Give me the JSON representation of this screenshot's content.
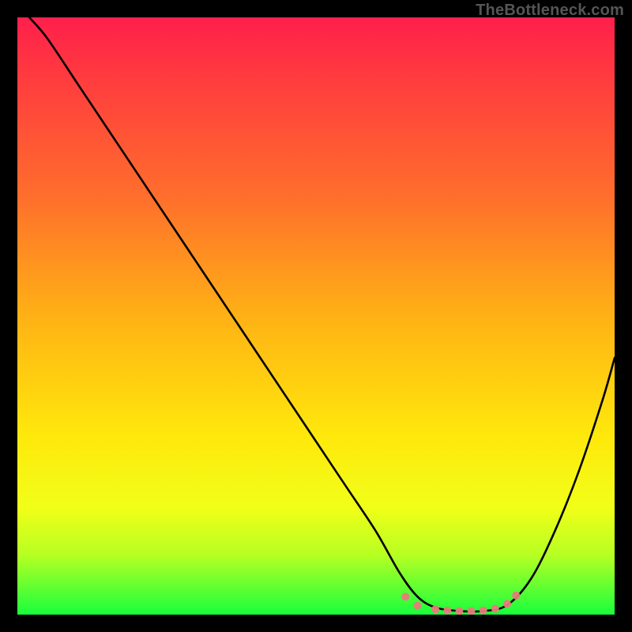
{
  "watermark": "TheBottleneck.com",
  "colors": {
    "frame": "#000000",
    "curve": "#000000",
    "marker": "#e97b7b",
    "gradient_top": "#ff1f4b",
    "gradient_mid": "#ffe80c",
    "gradient_bottom": "#17ff3c"
  },
  "chart_data": {
    "type": "line",
    "title": "",
    "xlabel": "",
    "ylabel": "",
    "xlim": [
      0,
      100
    ],
    "ylim": [
      0,
      100
    ],
    "grid": false,
    "legend": false,
    "series": [
      {
        "name": "bottleneck-curve",
        "x": [
          2,
          5,
          10,
          15,
          20,
          25,
          30,
          35,
          40,
          45,
          50,
          55,
          60,
          64,
          67,
          70,
          74,
          78,
          82,
          86,
          90,
          94,
          98,
          100
        ],
        "values": [
          100,
          96.5,
          89,
          81.5,
          74,
          66.5,
          59,
          51.5,
          44,
          36.5,
          29,
          21.5,
          14,
          7,
          3,
          1.2,
          0.6,
          0.6,
          1.6,
          6,
          14,
          24,
          36,
          43
        ]
      }
    ],
    "markers": [
      {
        "name": "left-band-start",
        "x": 65,
        "y": 3.0
      },
      {
        "name": "left-band-end",
        "x": 67,
        "y": 1.5
      },
      {
        "name": "floor-1",
        "x": 70,
        "y": 0.9
      },
      {
        "name": "floor-2",
        "x": 72,
        "y": 0.7
      },
      {
        "name": "floor-3",
        "x": 74,
        "y": 0.6
      },
      {
        "name": "floor-4",
        "x": 76,
        "y": 0.6
      },
      {
        "name": "floor-5",
        "x": 78,
        "y": 0.7
      },
      {
        "name": "floor-6",
        "x": 80,
        "y": 1.0
      },
      {
        "name": "right-band-start",
        "x": 82,
        "y": 1.8
      },
      {
        "name": "right-band-end",
        "x": 83.5,
        "y": 3.2
      }
    ]
  }
}
